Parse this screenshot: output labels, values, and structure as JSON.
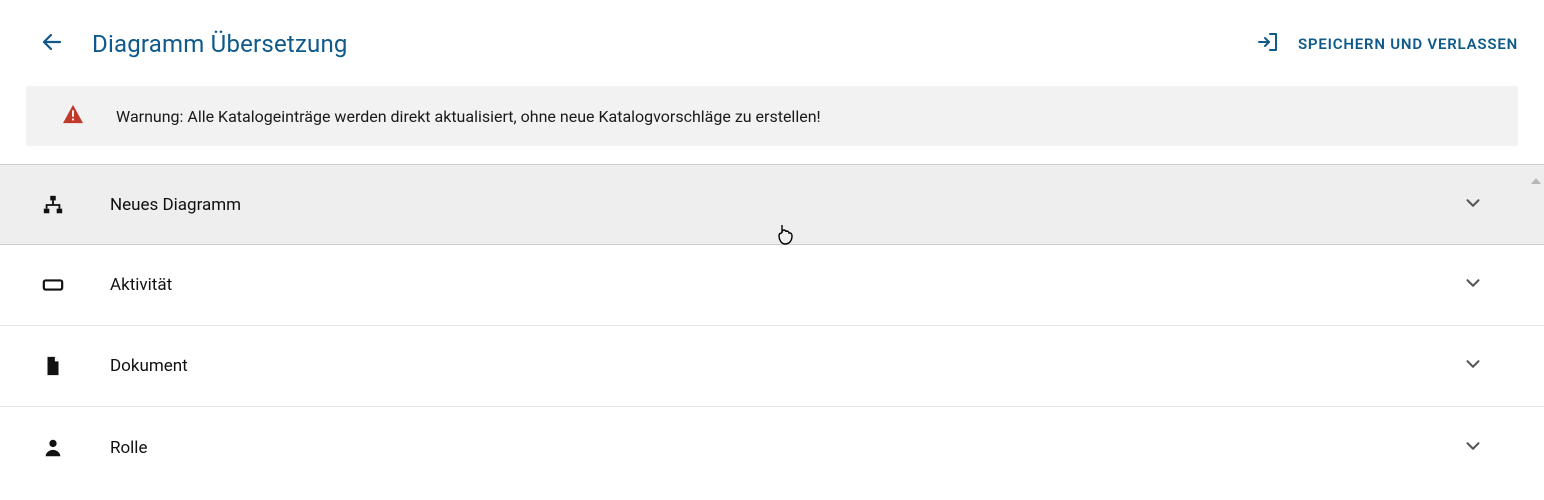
{
  "header": {
    "title": "Diagramm Übersetzung",
    "save_exit_label": "SPEICHERN UND VERLASSEN"
  },
  "warning": {
    "text": "Warnung: Alle Katalogeinträge werden direkt aktualisiert, ohne neue Katalogvorschläge zu erstellen!"
  },
  "rows": [
    {
      "icon": "sitemap-icon",
      "label": "Neues Diagramm",
      "selected": true
    },
    {
      "icon": "activity-icon",
      "label": "Aktivität",
      "selected": false
    },
    {
      "icon": "document-icon",
      "label": "Dokument",
      "selected": false
    },
    {
      "icon": "person-icon",
      "label": "Rolle",
      "selected": false
    }
  ]
}
